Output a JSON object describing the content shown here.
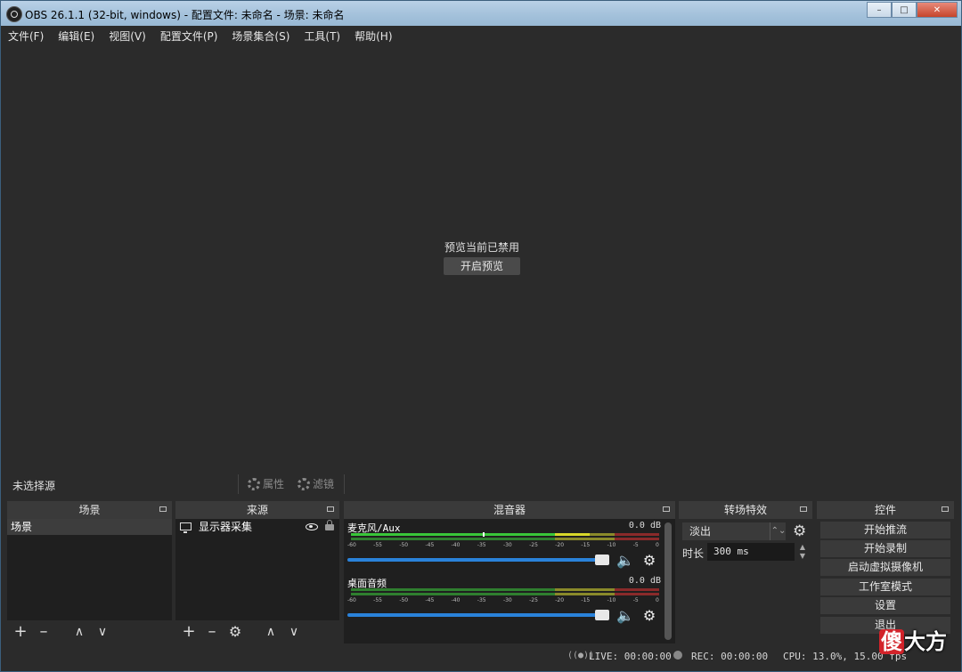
{
  "window": {
    "title": "OBS 26.1.1 (32-bit, windows) - 配置文件: 未命名 - 场景: 未命名"
  },
  "menu": [
    "文件(F)",
    "编辑(E)",
    "视图(V)",
    "配置文件(P)",
    "场景集合(S)",
    "工具(T)",
    "帮助(H)"
  ],
  "preview": {
    "message": "预览当前已禁用",
    "enable_button": "开启预览"
  },
  "source_toolbar": {
    "no_source": "未选择源",
    "properties": "属性",
    "filters": "滤镜"
  },
  "docks": {
    "scenes": {
      "title": "场景",
      "items": [
        "场景"
      ]
    },
    "sources": {
      "title": "来源",
      "items": [
        "显示器采集"
      ]
    },
    "mixer": {
      "title": "混音器",
      "scale": [
        "-60",
        "-55",
        "-50",
        "-45",
        "-40",
        "-35",
        "-30",
        "-25",
        "-20",
        "-15",
        "-10",
        "-5",
        "0"
      ],
      "channels": [
        {
          "name": "麦克风/Aux",
          "db": "0.0 dB"
        },
        {
          "name": "桌面音频",
          "db": "0.0 dB"
        }
      ]
    },
    "transitions": {
      "title": "转场特效",
      "selected": "淡出",
      "duration_label": "时长",
      "duration_value": "300 ms"
    },
    "controls": {
      "title": "控件",
      "buttons": [
        "开始推流",
        "开始录制",
        "启动虚拟摄像机",
        "工作室模式",
        "设置",
        "退出"
      ]
    }
  },
  "status": {
    "live": "LIVE: 00:00:00",
    "rec": "REC: 00:00:00",
    "cpu": "CPU: 13.0%, 15.00 fps"
  },
  "watermark": {
    "first": "傻",
    "rest": "大方"
  }
}
